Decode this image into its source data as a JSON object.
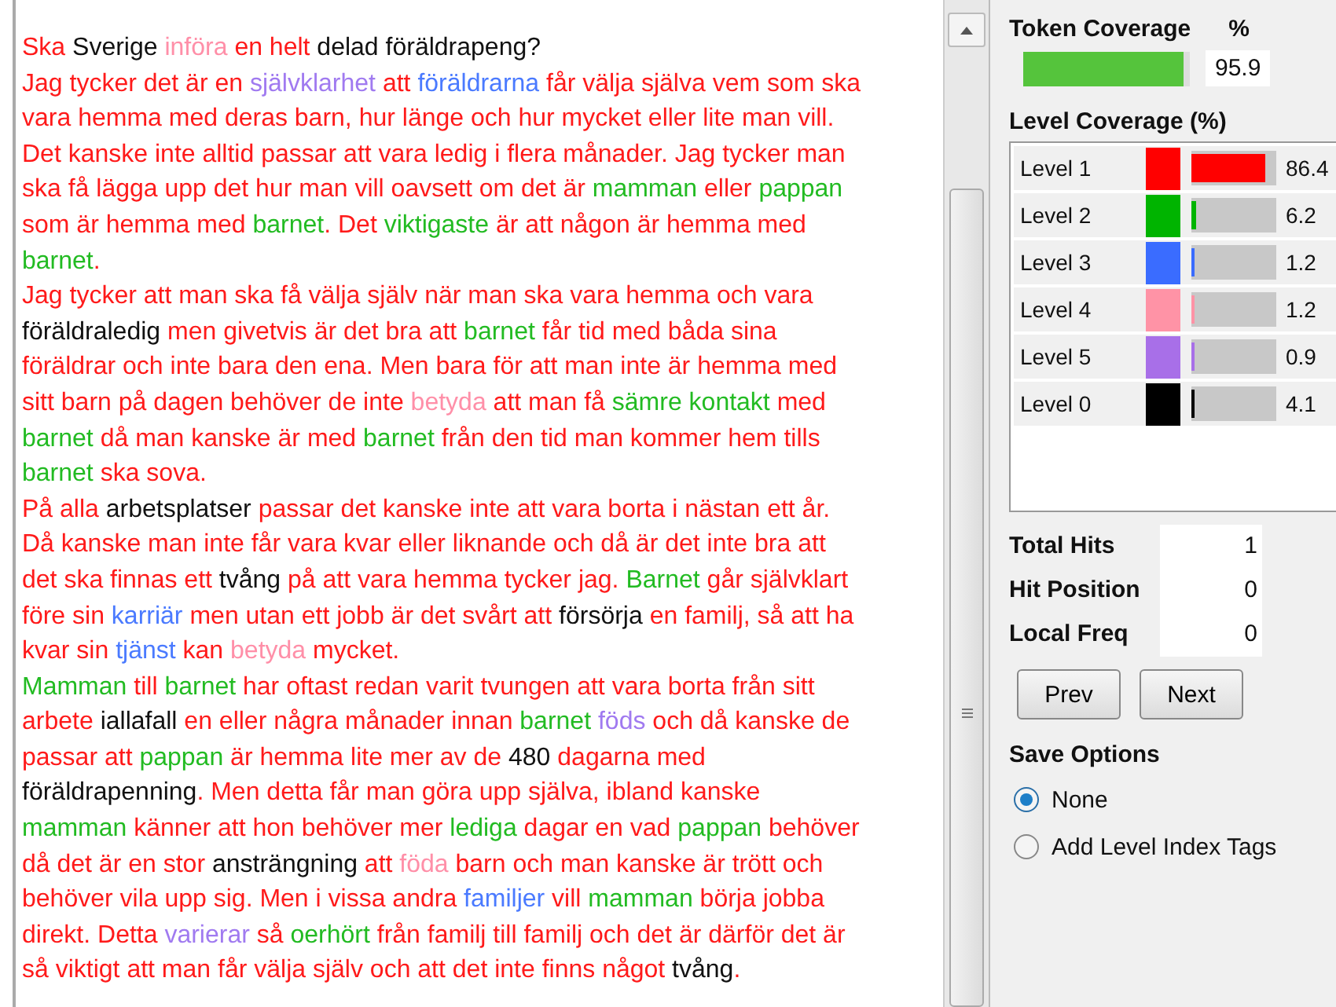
{
  "text_panel": {
    "lines": [
      {
        "segments": [
          {
            "text": "Ska ",
            "color": "#ff1a1a"
          },
          {
            "text": "Sverige ",
            "color": "#111111"
          },
          {
            "text": "införa ",
            "color": "#ff8fa8"
          },
          {
            "text": "en helt ",
            "color": "#ff1a1a"
          },
          {
            "text": "delad föräldrapeng?",
            "color": "#111111"
          }
        ]
      },
      {
        "segments": [
          {
            "text": "Jag tycker det är en ",
            "color": "#ff1a1a"
          },
          {
            "text": "självklarhet",
            "color": "#a07af0"
          },
          {
            "text": " att ",
            "color": "#ff1a1a"
          },
          {
            "text": "föräldrarna",
            "color": "#4a7aff"
          },
          {
            "text": " får välja själva vem som ska",
            "color": "#ff1a1a"
          }
        ]
      },
      {
        "segments": [
          {
            "text": "vara hemma med deras barn, hur länge och hur mycket eller lite man vill.",
            "color": "#ff1a1a"
          }
        ]
      },
      {
        "segments": [
          {
            "text": "Det kanske inte alltid passar att vara ledig i flera månader. Jag tycker man",
            "color": "#ff1a1a"
          }
        ]
      },
      {
        "segments": [
          {
            "text": "ska få lägga upp det hur man vill oavsett om det är ",
            "color": "#ff1a1a"
          },
          {
            "text": "mamman",
            "color": "#22bb22"
          },
          {
            "text": " eller ",
            "color": "#ff1a1a"
          },
          {
            "text": "pappan",
            "color": "#22bb22"
          }
        ]
      },
      {
        "segments": [
          {
            "text": "som är hemma med ",
            "color": "#ff1a1a"
          },
          {
            "text": "barnet",
            "color": "#22bb22"
          },
          {
            "text": ". Det ",
            "color": "#ff1a1a"
          },
          {
            "text": "viktigaste",
            "color": "#22bb22"
          },
          {
            "text": " är att någon är hemma med",
            "color": "#ff1a1a"
          }
        ]
      },
      {
        "segments": [
          {
            "text": "barnet",
            "color": "#22bb22"
          },
          {
            "text": ".",
            "color": "#ff1a1a"
          }
        ]
      },
      {
        "segments": [
          {
            "text": "Jag tycker att man ska få välja själv när man ska vara hemma och vara",
            "color": "#ff1a1a"
          }
        ]
      },
      {
        "segments": [
          {
            "text": "föräldraledig",
            "color": "#111111"
          },
          {
            "text": " men givetvis är det bra att ",
            "color": "#ff1a1a"
          },
          {
            "text": "barnet",
            "color": "#22bb22"
          },
          {
            "text": " får tid med båda sina",
            "color": "#ff1a1a"
          }
        ]
      },
      {
        "segments": [
          {
            "text": "föräldrar och inte bara den ena. Men bara för att man inte är hemma med",
            "color": "#ff1a1a"
          }
        ]
      },
      {
        "segments": [
          {
            "text": "sitt barn på dagen behöver de inte ",
            "color": "#ff1a1a"
          },
          {
            "text": "betyda",
            "color": "#ff8fa8"
          },
          {
            "text": " att man få ",
            "color": "#ff1a1a"
          },
          {
            "text": "sämre kontakt",
            "color": "#22bb22"
          },
          {
            "text": " med",
            "color": "#ff1a1a"
          }
        ]
      },
      {
        "segments": [
          {
            "text": "barnet",
            "color": "#22bb22"
          },
          {
            "text": " då man kanske är med ",
            "color": "#ff1a1a"
          },
          {
            "text": "barnet",
            "color": "#22bb22"
          },
          {
            "text": " från den tid man kommer hem tills",
            "color": "#ff1a1a"
          }
        ]
      },
      {
        "segments": [
          {
            "text": "barnet",
            "color": "#22bb22"
          },
          {
            "text": " ska sova.",
            "color": "#ff1a1a"
          }
        ]
      },
      {
        "segments": [
          {
            "text": "På alla ",
            "color": "#ff1a1a"
          },
          {
            "text": "arbetsplatser",
            "color": "#111111"
          },
          {
            "text": " passar det kanske inte att vara borta i nästan ett år.",
            "color": "#ff1a1a"
          }
        ]
      },
      {
        "segments": [
          {
            "text": "Då kanske man inte får vara kvar eller liknande och då är det inte bra att",
            "color": "#ff1a1a"
          }
        ]
      },
      {
        "segments": [
          {
            "text": "det ska finnas ett ",
            "color": "#ff1a1a"
          },
          {
            "text": "tvång",
            "color": "#111111"
          },
          {
            "text": " på att vara hemma tycker jag. ",
            "color": "#ff1a1a"
          },
          {
            "text": "Barnet",
            "color": "#22bb22"
          },
          {
            "text": " går självklart",
            "color": "#ff1a1a"
          }
        ]
      },
      {
        "segments": [
          {
            "text": "före sin ",
            "color": "#ff1a1a"
          },
          {
            "text": "karriär",
            "color": "#4a7aff"
          },
          {
            "text": " men utan ett jobb är det svårt att ",
            "color": "#ff1a1a"
          },
          {
            "text": "försörja",
            "color": "#111111"
          },
          {
            "text": " en familj, så att ha",
            "color": "#ff1a1a"
          }
        ]
      },
      {
        "segments": [
          {
            "text": "kvar sin ",
            "color": "#ff1a1a"
          },
          {
            "text": "tjänst",
            "color": "#4a7aff"
          },
          {
            "text": " kan ",
            "color": "#ff1a1a"
          },
          {
            "text": "betyda",
            "color": "#ff8fa8"
          },
          {
            "text": " mycket.",
            "color": "#ff1a1a"
          }
        ]
      },
      {
        "segments": [
          {
            "text": "Mamman",
            "color": "#22bb22"
          },
          {
            "text": " till ",
            "color": "#ff1a1a"
          },
          {
            "text": "barnet",
            "color": "#22bb22"
          },
          {
            "text": " har oftast redan varit tvungen att vara borta från sitt",
            "color": "#ff1a1a"
          }
        ]
      },
      {
        "segments": [
          {
            "text": "arbete ",
            "color": "#ff1a1a"
          },
          {
            "text": "iallafall",
            "color": "#111111"
          },
          {
            "text": " en eller några månader innan ",
            "color": "#ff1a1a"
          },
          {
            "text": "barnet ",
            "color": "#22bb22"
          },
          {
            "text": "föds",
            "color": "#a07af0"
          },
          {
            "text": " och då kanske de",
            "color": "#ff1a1a"
          }
        ]
      },
      {
        "segments": [
          {
            "text": "passar att ",
            "color": "#ff1a1a"
          },
          {
            "text": "pappan",
            "color": "#22bb22"
          },
          {
            "text": " är hemma lite mer av de ",
            "color": "#ff1a1a"
          },
          {
            "text": "480",
            "color": "#111111"
          },
          {
            "text": " dagarna med",
            "color": "#ff1a1a"
          }
        ]
      },
      {
        "segments": [
          {
            "text": "föräldrapenning",
            "color": "#111111"
          },
          {
            "text": ". Men detta får man göra upp själva, ibland kanske",
            "color": "#ff1a1a"
          }
        ]
      },
      {
        "segments": [
          {
            "text": "mamman",
            "color": "#22bb22"
          },
          {
            "text": " känner att hon behöver mer ",
            "color": "#ff1a1a"
          },
          {
            "text": "lediga",
            "color": "#22bb22"
          },
          {
            "text": " dagar en vad ",
            "color": "#ff1a1a"
          },
          {
            "text": "pappan",
            "color": "#22bb22"
          },
          {
            "text": " behöver",
            "color": "#ff1a1a"
          }
        ]
      },
      {
        "segments": [
          {
            "text": "då det är en stor ",
            "color": "#ff1a1a"
          },
          {
            "text": "ansträngning",
            "color": "#111111"
          },
          {
            "text": " att ",
            "color": "#ff1a1a"
          },
          {
            "text": "föda",
            "color": "#ff8fa8"
          },
          {
            "text": " barn och man kanske är trött och",
            "color": "#ff1a1a"
          }
        ]
      },
      {
        "segments": [
          {
            "text": "behöver vila upp sig. Men i vissa andra ",
            "color": "#ff1a1a"
          },
          {
            "text": "familjer",
            "color": "#4a7aff"
          },
          {
            "text": " vill ",
            "color": "#ff1a1a"
          },
          {
            "text": "mamman",
            "color": "#22bb22"
          },
          {
            "text": " börja jobba",
            "color": "#ff1a1a"
          }
        ]
      },
      {
        "segments": [
          {
            "text": "direkt. Detta ",
            "color": "#ff1a1a"
          },
          {
            "text": "varierar",
            "color": "#a07af0"
          },
          {
            "text": " så ",
            "color": "#ff1a1a"
          },
          {
            "text": "oerhört",
            "color": "#22bb22"
          },
          {
            "text": " från familj till familj och det är därför det är",
            "color": "#ff1a1a"
          }
        ]
      },
      {
        "segments": [
          {
            "text": "så viktigt att man får välja själv och att det inte finns något ",
            "color": "#ff1a1a"
          },
          {
            "text": "tvång",
            "color": "#111111"
          },
          {
            "text": ".",
            "color": "#ff1a1a"
          }
        ]
      }
    ]
  },
  "token_coverage": {
    "label": "Token Coverage",
    "unit": "%",
    "level": 0.959,
    "reading": "95.9"
  },
  "level_coverage": {
    "title": "Level Coverage (%)",
    "levels": [
      {
        "name": "Level 1",
        "color": "#ff0000",
        "level": 0.864,
        "reading": "86.4"
      },
      {
        "name": "Level 2",
        "color": "#00b400",
        "level": 0.062,
        "reading": "6.2"
      },
      {
        "name": "Level 3",
        "color": "#3a6cff",
        "level": 0.012,
        "reading": "1.2"
      },
      {
        "name": "Level 4",
        "color": "#ff93a6",
        "level": 0.012,
        "reading": "1.2"
      },
      {
        "name": "Level 5",
        "color": "#a86fe8",
        "level": 0.009,
        "reading": "0.9"
      },
      {
        "name": "Level 0",
        "color": "#000000",
        "level": 0.041,
        "reading": "4.1"
      }
    ]
  },
  "stats": [
    {
      "label": "Total Hits",
      "value": "1"
    },
    {
      "label": "Hit Position",
      "value": "0"
    },
    {
      "label": "Local Freq",
      "value": "0"
    }
  ],
  "buttons": [
    "Prev",
    "Next"
  ],
  "save_options": {
    "title": "Save Options",
    "options": [
      {
        "label": "None",
        "selected": true
      },
      {
        "label": "Add Level Index Tags",
        "selected": false
      }
    ]
  }
}
